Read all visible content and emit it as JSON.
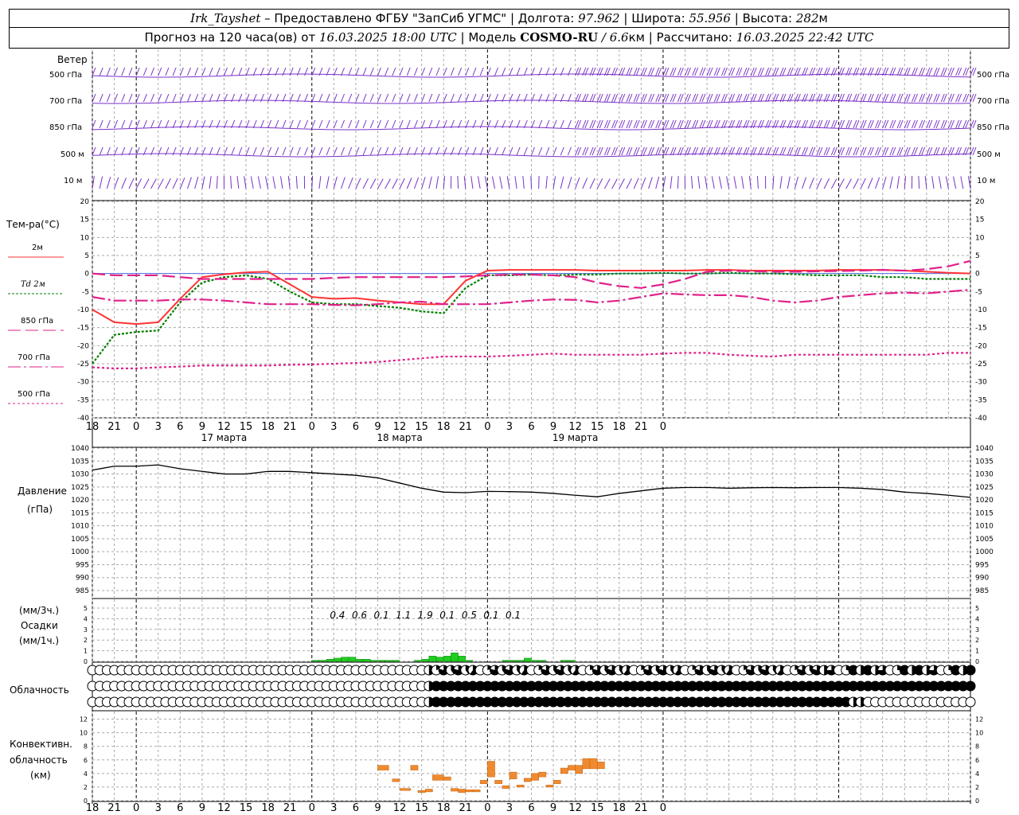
{
  "header": {
    "station": "Irk_Tayshet",
    "dash": " – ",
    "provided": "Предоставлено ФГБУ \"ЗапСиб УГМС\"",
    "lon_label": "Долгота:",
    "lon": "97.962",
    "lat_label": "Широта:",
    "lat": "55.956",
    "alt_label": "Высота:",
    "alt": "282",
    "alt_unit": "м",
    "sep": " | "
  },
  "subheader": {
    "forecast": "Прогноз на 120 часа(ов) от",
    "start": "16.03.2025 18:00 UTC",
    "model_label": "Модель",
    "model": "COSMO-RU",
    "res": "/ 6.6",
    "res_unit": "км",
    "calc_label": "Рассчитано:",
    "calc": "16.03.2025 22:42 UTC"
  },
  "panels": {
    "wind": {
      "title": "Ветер",
      "levels": [
        "500 гПа",
        "700 гПа",
        "850 гПа",
        "500 м",
        "10 м"
      ]
    },
    "temp": {
      "title": "Тем-ра(°C)",
      "legend": [
        {
          "label": "2м",
          "color": "#ff3333"
        },
        {
          "label": "Td 2м",
          "color": "#008000"
        },
        {
          "label": "850 гПа",
          "color": "#e0208a"
        },
        {
          "label": "700 гПа",
          "color": "#e0208a"
        },
        {
          "label": "500 гПа",
          "color": "#e0208a"
        }
      ]
    },
    "pressure": {
      "title": "Давление",
      "unit": "(гПа)"
    },
    "precip": {
      "unit1": "(мм/3ч.)",
      "title": "Осадки",
      "unit2": "(мм/1ч.)"
    },
    "cloud": {
      "title": "Облачность"
    },
    "conv": {
      "title1": "Конвективн.",
      "title2": "облачность",
      "unit": "(км)"
    }
  },
  "time_axis": {
    "labels": [
      "18",
      "21",
      "0",
      "3",
      "6",
      "9",
      "12",
      "15",
      "18",
      "21",
      "0",
      "3",
      "6",
      "9",
      "12",
      "15",
      "18",
      "21",
      "0",
      "3",
      "6",
      "9",
      "12",
      "15",
      "18",
      "21",
      "0"
    ],
    "days": [
      "17 марта",
      "18 марта",
      "19 марта"
    ]
  },
  "chart_data": [
    {
      "type": "line",
      "title": "Тем-ра(°C)",
      "x_hours_from_start": [
        0,
        3,
        6,
        9,
        12,
        15,
        18,
        21,
        24,
        27,
        30,
        33,
        36,
        39,
        42,
        45,
        48,
        51,
        54,
        57,
        60,
        63,
        66,
        69,
        72,
        75,
        78,
        81,
        84,
        87,
        90,
        93,
        96,
        99,
        102,
        105,
        108,
        111,
        114,
        117,
        120
      ],
      "ylim": [
        -40,
        20
      ],
      "yticks": [
        20,
        15,
        10,
        5,
        0,
        -5,
        -10,
        -15,
        -20,
        -25,
        -30,
        -35,
        -40
      ],
      "series": [
        {
          "name": "2м",
          "color": "#ff3333",
          "dash": "",
          "values": [
            -10,
            -13.5,
            -14,
            -13.5,
            -7,
            -1,
            -0.2,
            0.3,
            0.5,
            -3,
            -6.5,
            -7,
            -6.8,
            -7.5,
            -8,
            -8.5,
            -8.5,
            -2,
            0.8,
            1,
            1,
            1,
            1,
            0.8,
            0.8,
            0.8,
            0.8,
            0.8,
            1,
            1,
            0.8,
            0.8,
            0.8,
            0.8,
            1,
            1,
            1,
            0.8,
            0.5,
            0.2,
            0
          ]
        },
        {
          "name": "Td 2м",
          "color": "#008000",
          "dash": "3,2",
          "values": [
            -25,
            -17,
            -16.2,
            -15.8,
            -8,
            -2.5,
            -1,
            -0.5,
            -1.5,
            -5,
            -8,
            -8.5,
            -8.5,
            -9,
            -9.5,
            -10.5,
            -11,
            -4,
            -0.5,
            -0.5,
            -0.3,
            -0.5,
            -0.3,
            -0.3,
            0,
            0,
            0.2,
            0,
            0,
            0.2,
            0,
            0,
            -0.2,
            -0.5,
            -0.5,
            -0.5,
            -1,
            -1,
            -1.5,
            -1.5,
            -1.5
          ]
        },
        {
          "name": "850 гПа",
          "color": "#e0208a",
          "dash": "16,6",
          "values": [
            0,
            -0.5,
            -0.5,
            -0.5,
            -1,
            -1.5,
            -1.5,
            -1.5,
            -1.5,
            -1.5,
            -1.5,
            -1.2,
            -1,
            -1,
            -1,
            -1,
            -1,
            -0.8,
            -0.5,
            -0.3,
            -0.3,
            -0.5,
            -1,
            -2.5,
            -3.5,
            -4,
            -3,
            -1.5,
            0.5,
            0.8,
            0.6,
            0.5,
            0.5,
            0.6,
            0.7,
            0.8,
            1,
            0.8,
            1.2,
            2,
            3.5
          ]
        },
        {
          "name": "700 гПа",
          "color": "#e0208a",
          "dash": "16,4,3,4",
          "values": [
            -6.5,
            -7.5,
            -7.5,
            -7.5,
            -7.2,
            -7.2,
            -7.5,
            -8,
            -8.5,
            -8.5,
            -8.5,
            -8.7,
            -8.8,
            -8.5,
            -8,
            -7.8,
            -8.5,
            -8.5,
            -8.5,
            -8,
            -7.5,
            -7.2,
            -7.3,
            -8,
            -7.5,
            -6.5,
            -5.5,
            -5.8,
            -6,
            -6,
            -6.5,
            -7.5,
            -8,
            -7.5,
            -6.5,
            -6,
            -5.5,
            -5.3,
            -5.5,
            -5,
            -4.5
          ]
        },
        {
          "name": "500 гПа",
          "color": "#e0208a",
          "dash": "3,3",
          "values": [
            -26,
            -26.3,
            -26.3,
            -26,
            -25.8,
            -25.5,
            -25.5,
            -25.5,
            -25.5,
            -25.3,
            -25.2,
            -25,
            -24.8,
            -24.5,
            -24,
            -23.5,
            -23,
            -23,
            -23,
            -22.8,
            -22.5,
            -22.2,
            -22.5,
            -22.5,
            -22.5,
            -22.5,
            -22.2,
            -22,
            -22,
            -22.5,
            -22.8,
            -23,
            -22.5,
            -22.5,
            -22.5,
            -22.5,
            -22.5,
            -22.5,
            -22.5,
            -22,
            -22
          ]
        }
      ]
    },
    {
      "type": "line",
      "title": "Давление",
      "ylabel": "(гПа)",
      "x_hours_from_start": [
        0,
        3,
        6,
        9,
        12,
        15,
        18,
        21,
        24,
        27,
        30,
        33,
        36,
        39,
        42,
        45,
        48,
        51,
        54,
        57,
        60,
        63,
        66,
        69,
        72,
        75,
        78,
        81,
        84,
        87,
        90,
        93,
        96,
        99,
        102,
        105,
        108,
        111,
        114,
        117,
        120
      ],
      "ylim": [
        985,
        1040
      ],
      "yticks": [
        1040,
        1035,
        1030,
        1025,
        1020,
        1015,
        1010,
        1005,
        1000,
        995,
        990,
        985
      ],
      "series": [
        {
          "name": "",
          "color": "#000000",
          "values": [
            1031.5,
            1033,
            1033,
            1033.5,
            1032,
            1031,
            1030,
            1030,
            1031,
            1031,
            1030.5,
            1030,
            1029.5,
            1028.5,
            1026.5,
            1024.5,
            1023,
            1022.8,
            1023.3,
            1023.2,
            1023,
            1022.5,
            1021.8,
            1021.2,
            1022.5,
            1023.5,
            1024.5,
            1024.8,
            1024.8,
            1024.5,
            1024.7,
            1024.8,
            1024.7,
            1024.8,
            1024.8,
            1024.5,
            1024,
            1023,
            1022.5,
            1021.8,
            1021
          ]
        }
      ]
    },
    {
      "type": "bar",
      "title": "Осадки",
      "ylim": [
        0,
        5
      ],
      "yticks": [
        5,
        4,
        3,
        2,
        1,
        0
      ],
      "hourly_from_hour": 30,
      "hourly_values": [
        0.1,
        0.1,
        0.2,
        0.3,
        0.4,
        0.4,
        0.2,
        0.2,
        0.1,
        0.1,
        0.1,
        0.1,
        0,
        0,
        0.1,
        0.2,
        0.5,
        0.4,
        0.5,
        0.8,
        0.5,
        0.1,
        0,
        0,
        0,
        0,
        0.1,
        0.1,
        0.1,
        0.3,
        0.1,
        0.1,
        0,
        0,
        0.1,
        0.1,
        0,
        0
      ],
      "sum3h_labels": [
        "0.4",
        "0.6",
        "0.1",
        "1.1",
        "1.9",
        "0.1",
        "0.5",
        "0.1",
        "0.1"
      ]
    },
    {
      "type": "table",
      "title": "Облачность",
      "rows": 3,
      "note": "cloud cover fraction per hour: 0 = clear, 1 = overcast",
      "step_hours": 1,
      "levels": [
        "upper",
        "middle",
        "lower"
      ]
    },
    {
      "type": "bar",
      "title": "Конвективн. облачность",
      "ylabel": "(км)",
      "ylim": [
        0,
        13
      ],
      "yticks": [
        12,
        10,
        8,
        6,
        4,
        2,
        0
      ],
      "bars_km": [
        [
          39,
          40.5,
          4.5,
          5.2
        ],
        [
          41,
          42,
          2.8,
          3.2
        ],
        [
          42,
          43.5,
          1.5,
          1.8
        ],
        [
          43.5,
          44.5,
          4.5,
          5.2
        ],
        [
          44.5,
          45.5,
          1.2,
          1.5
        ],
        [
          45.5,
          46.5,
          1.3,
          1.7
        ],
        [
          46.5,
          48,
          3,
          3.8
        ],
        [
          48,
          49,
          3,
          3.5
        ],
        [
          49,
          50,
          1.4,
          1.8
        ],
        [
          50,
          51,
          1.2,
          1.7
        ],
        [
          51,
          52,
          1.3,
          1.6
        ],
        [
          52,
          53,
          1.3,
          1.6
        ],
        [
          53,
          54,
          2.5,
          3
        ],
        [
          54,
          55,
          3.5,
          5.8
        ],
        [
          55,
          56,
          2.5,
          3
        ],
        [
          56,
          57,
          1.8,
          2.2
        ],
        [
          57,
          58,
          3.2,
          4.2
        ],
        [
          58,
          59,
          2,
          2.3
        ],
        [
          59,
          60,
          2.8,
          3.3
        ],
        [
          60,
          61,
          3,
          4
        ],
        [
          61,
          62,
          3.5,
          4.2
        ],
        [
          62,
          63,
          2,
          2.3
        ],
        [
          63,
          64,
          2.5,
          3
        ],
        [
          64,
          65,
          4,
          4.8
        ],
        [
          65,
          66,
          4.5,
          5.2
        ],
        [
          66,
          67,
          4,
          5.2
        ],
        [
          67,
          68,
          4.7,
          6.2
        ],
        [
          68,
          69,
          4.7,
          6.2
        ],
        [
          69,
          70,
          4.7,
          5.7
        ]
      ]
    }
  ]
}
